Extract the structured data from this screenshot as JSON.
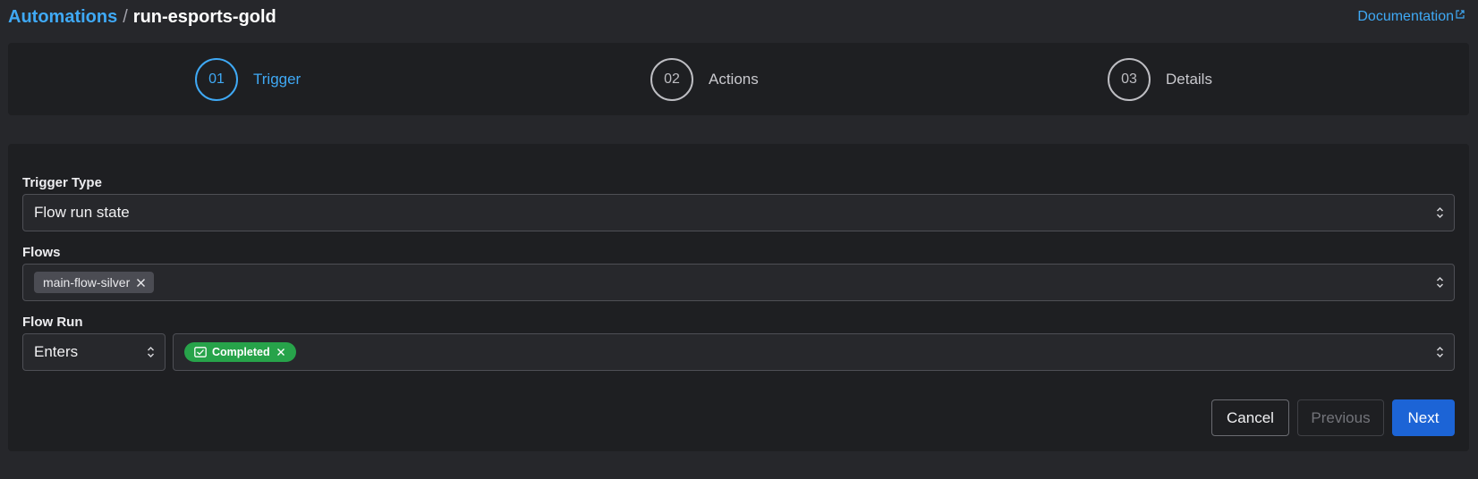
{
  "breadcrumb": {
    "parent": "Automations",
    "separator": "/",
    "current": "run-esports-gold"
  },
  "header": {
    "documentation_label": "Documentation",
    "documentation_icon": "external-link-icon"
  },
  "stepper": {
    "steps": [
      {
        "number": "01",
        "label": "Trigger",
        "active": true
      },
      {
        "number": "02",
        "label": "Actions",
        "active": false
      },
      {
        "number": "03",
        "label": "Details",
        "active": false
      }
    ]
  },
  "form": {
    "trigger_type": {
      "label": "Trigger Type",
      "value": "Flow run state"
    },
    "flows": {
      "label": "Flows",
      "tags": [
        "main-flow-silver"
      ]
    },
    "flow_run": {
      "label": "Flow Run",
      "condition": "Enters",
      "states": [
        {
          "label": "Completed",
          "color": "#27a34a",
          "icon": "completed-check-icon"
        }
      ]
    }
  },
  "actions": {
    "cancel_label": "Cancel",
    "previous_label": "Previous",
    "next_label": "Next"
  },
  "colors": {
    "accent": "#3fa9f5",
    "primary_button": "#1c64d6",
    "completed": "#27a34a"
  }
}
